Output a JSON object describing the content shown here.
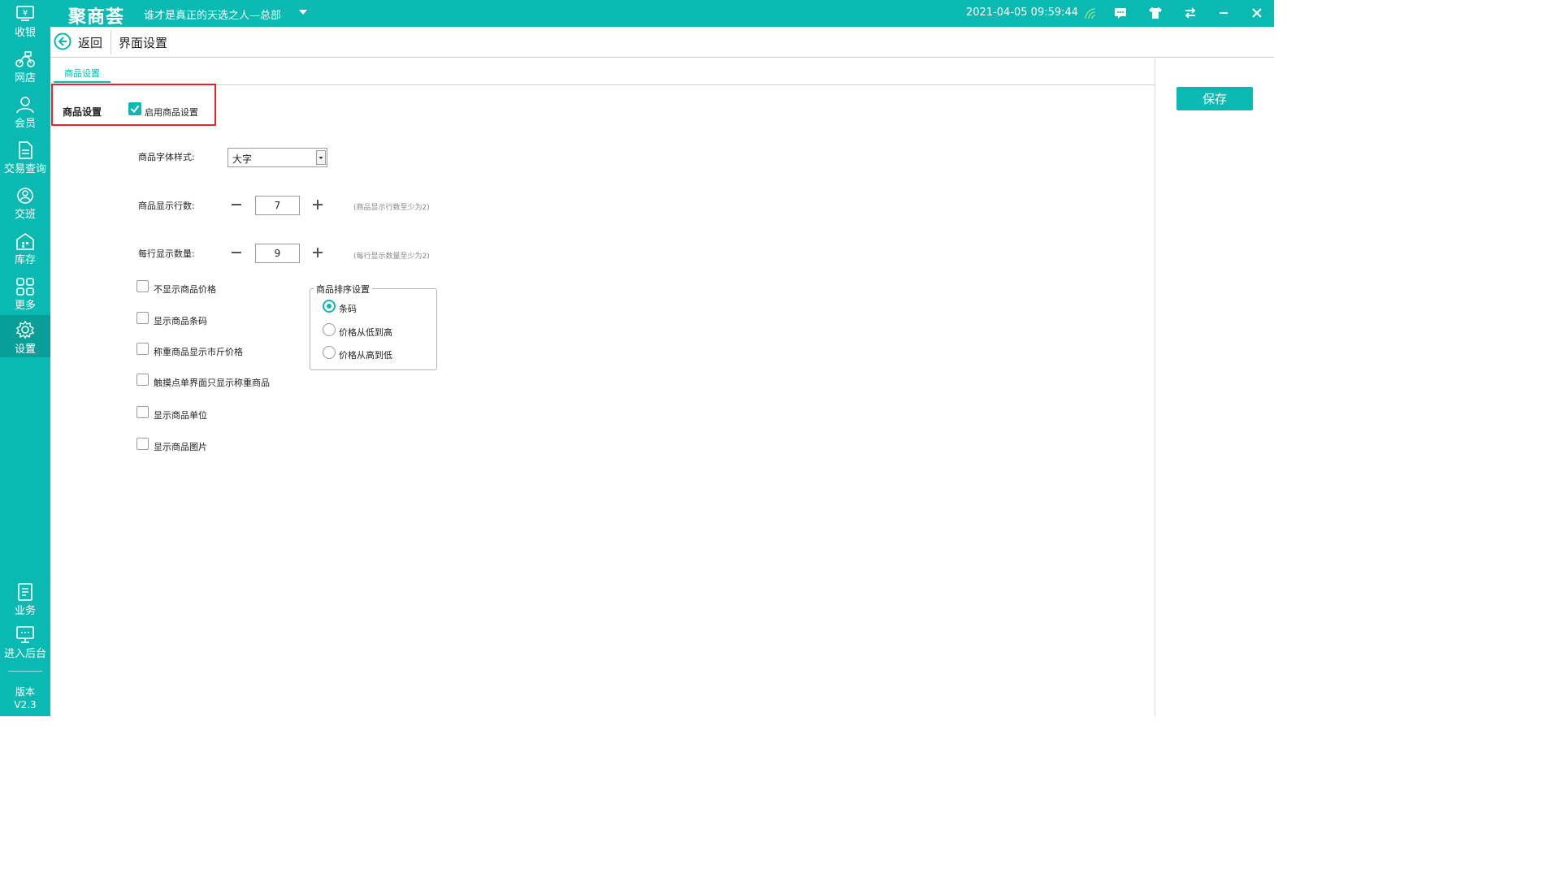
{
  "app": {
    "logo": "聚商荟",
    "store_name": "谁才是真正的天选之人—总部",
    "datetime": "2021-04-05 09:59:44"
  },
  "sidebar": {
    "items": [
      {
        "label": "收银",
        "icon": "yen-register-icon"
      },
      {
        "label": "网店",
        "icon": "delivery-bike-icon"
      },
      {
        "label": "会员",
        "icon": "member-user-icon"
      },
      {
        "label": "交易查询",
        "icon": "document-icon"
      },
      {
        "label": "交班",
        "icon": "shift-handover-icon"
      },
      {
        "label": "库存",
        "icon": "warehouse-icon"
      },
      {
        "label": "更多",
        "icon": "grid-icon"
      },
      {
        "label": "设置",
        "icon": "gear-icon"
      },
      {
        "label": "业务",
        "icon": "book-icon"
      },
      {
        "label": "进入后台",
        "icon": "monitor-icon"
      }
    ],
    "active": "设置",
    "version_label": "版本",
    "version_number": "V2.3"
  },
  "header": {
    "back_label": "返回",
    "title": "界面设置"
  },
  "tabs": [
    {
      "label": "商品设置",
      "active": true
    }
  ],
  "toolbar": {
    "save_label": "保存"
  },
  "enable_section": {
    "title": "商品设置",
    "checkbox_label": "启用商品设置",
    "checked": true
  },
  "form": {
    "font_style": {
      "label": "商品字体样式:",
      "value": "大字"
    },
    "rows": {
      "label": "商品显示行数:",
      "value": "7",
      "hint": "(商品显示行数至少为2)"
    },
    "per_row": {
      "label": "每行显示数量:",
      "value": "9",
      "hint": "(每行显示数量至少为2)"
    }
  },
  "options": [
    {
      "label": "不显示商品价格",
      "checked": false
    },
    {
      "label": "显示商品条码",
      "checked": false
    },
    {
      "label": "称重商品显示市斤价格",
      "checked": false
    },
    {
      "label": "触摸点单界面只显示称重商品",
      "checked": false
    },
    {
      "label": "显示商品单位",
      "checked": false
    },
    {
      "label": "显示商品图片",
      "checked": false
    }
  ],
  "sort": {
    "title": "商品排序设置",
    "options": [
      {
        "label": "条码",
        "selected": true
      },
      {
        "label": "价格从低到高",
        "selected": false
      },
      {
        "label": "价格从高到低",
        "selected": false
      }
    ]
  },
  "colors": {
    "accent": "#0ab9b1",
    "highlight_border": "#e8232a"
  }
}
